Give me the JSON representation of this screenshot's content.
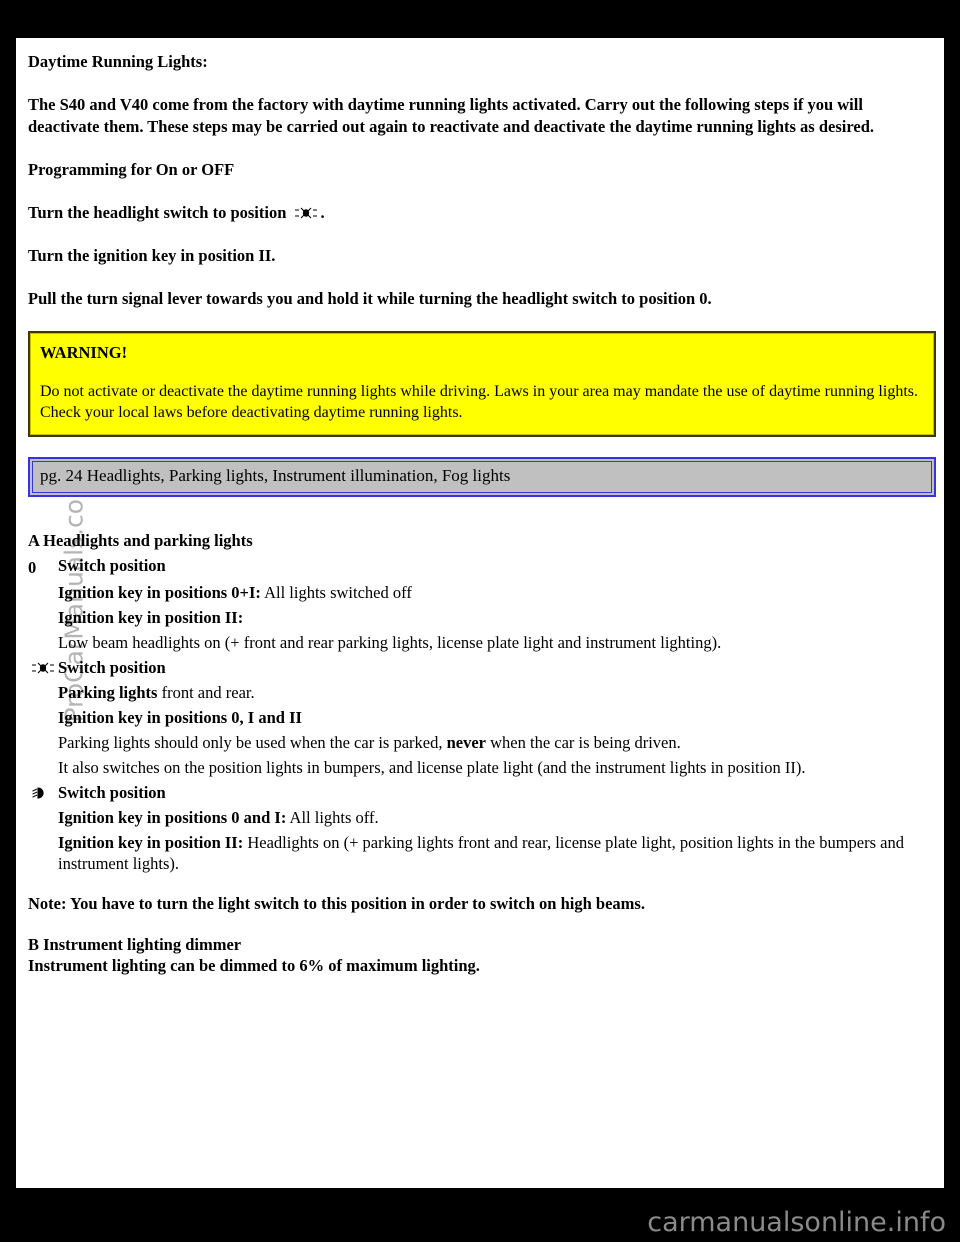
{
  "document": {
    "title_line": "Daytime Running Lights:",
    "intro": "The S40 and V40 come from the factory with daytime running lights activated. Carry out the following steps if you will deactivate them. These steps may be carried out again to reactivate and deactivate the daytime running lights as desired.",
    "programming_heading": "Programming for On or OFF",
    "step1_before": "Turn the headlight switch to position",
    "step1_after": ".",
    "step2": "Turn the ignition key in position II.",
    "step3": "Pull the turn signal lever towards you and hold it while turning the headlight switch to position 0."
  },
  "warning": {
    "title": "WARNING!",
    "text": "Do not activate or deactivate the daytime running lights while driving. Laws in your area may mandate the use of daytime running lights. Check your local laws before deactivating daytime running lights."
  },
  "page_bar": {
    "text": "pg. 24 Headlights, Parking lights, Instrument illumination, Fog lights"
  },
  "switch_section": {
    "heading": "A  Headlights and parking lights",
    "position_off": {
      "marker": "0",
      "label": "Switch position",
      "line1_bold": "Ignition key in positions 0+I:",
      "line1_rest": " All lights switched off",
      "line2_bold": "Ignition key in position II:",
      "line3": "Low beam headlights on (+ front and rear parking lights, license plate light and instrument lighting)."
    },
    "position_parking": {
      "marker_icon": "parking-lights-icon",
      "label": "Switch position",
      "line1_bold": "Parking lights",
      "line1_rest": " front and rear.",
      "line2_bold": "Ignition key in positions 0, I and II",
      "line3_a": "Parking lights should only be used when the car is parked, ",
      "line3_b": "never",
      "line3_c": " when the car is being driven.",
      "line4": "It also switches on the position lights in bumpers, and license plate light (and the instrument lights in position II)."
    },
    "position_headlight": {
      "marker_icon": "low-beam-headlight-icon",
      "label": "Switch position",
      "line1_bold": "Ignition key in positions 0 and I:",
      "line1_rest": " All lights off.",
      "line2_bold": "Ignition key in position II:",
      "line2_rest": " Headlights on (+ parking lights front and rear, license plate light, position lights in the bumpers and instrument lights)."
    },
    "note": "Note: You have to turn the light switch to this position in order to switch on high beams.",
    "dimmer_heading": "B Instrument lighting dimmer",
    "dimmer_text": "Instrument lighting can be dimmed to 6% of maximum lighting."
  },
  "watermark": {
    "side_text": "ProCarManuals.com",
    "footer_text": "carmanualsonline.info"
  },
  "colors": {
    "warning_bg": "#ffff00",
    "warning_border": "#3a3a00",
    "bar_bg": "#c0c0c0",
    "bar_border": "#3633e0",
    "page_bg": "#ffffff",
    "backdrop": "#000000",
    "watermark": "#b4b4b4"
  }
}
